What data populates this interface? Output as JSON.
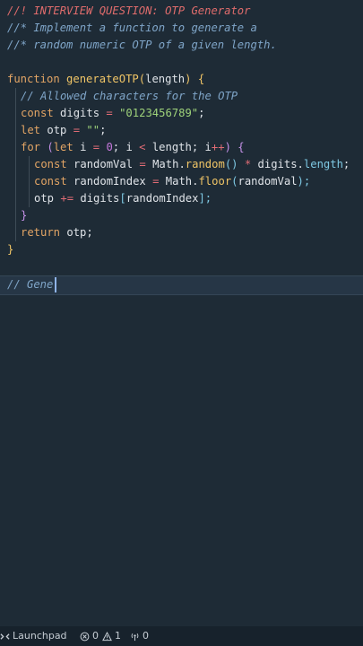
{
  "editor": {
    "lines": [
      {
        "indent": 0,
        "tokens": [
          {
            "t": "//! INTERVIEW QUESTION: OTP Generator",
            "c": "c-red"
          }
        ]
      },
      {
        "indent": 0,
        "tokens": [
          {
            "t": "//* Implement a function to generate a",
            "c": "c-com"
          }
        ]
      },
      {
        "indent": 0,
        "tokens": [
          {
            "t": "//* random numeric OTP of a given length.",
            "c": "c-com"
          }
        ]
      },
      {
        "indent": 0,
        "tokens": []
      },
      {
        "indent": 0,
        "tokens": [
          {
            "t": "function ",
            "c": "c-kw"
          },
          {
            "t": "generateOTP",
            "c": "c-fn"
          },
          {
            "t": "(",
            "c": "c-fn"
          },
          {
            "t": "length",
            "c": "c-pl"
          },
          {
            "t": ") {",
            "c": "c-fn"
          }
        ]
      },
      {
        "indent": 1,
        "tokens": [
          {
            "t": "// Allowed characters for the OTP",
            "c": "c-com"
          }
        ]
      },
      {
        "indent": 1,
        "tokens": [
          {
            "t": "const ",
            "c": "c-kw"
          },
          {
            "t": "digits ",
            "c": "c-pl"
          },
          {
            "t": "= ",
            "c": "c-op"
          },
          {
            "t": "\"0123456789\"",
            "c": "c-str"
          },
          {
            "t": ";",
            "c": "c-pl"
          }
        ]
      },
      {
        "indent": 1,
        "tokens": [
          {
            "t": "let ",
            "c": "c-kw"
          },
          {
            "t": "otp ",
            "c": "c-pl"
          },
          {
            "t": "= ",
            "c": "c-op"
          },
          {
            "t": "\"\"",
            "c": "c-str"
          },
          {
            "t": ";",
            "c": "c-pl"
          }
        ]
      },
      {
        "indent": 1,
        "tokens": [
          {
            "t": "for ",
            "c": "c-kw"
          },
          {
            "t": "(",
            "c": "c-br"
          },
          {
            "t": "let ",
            "c": "c-kw"
          },
          {
            "t": "i ",
            "c": "c-pl"
          },
          {
            "t": "= ",
            "c": "c-op"
          },
          {
            "t": "0",
            "c": "c-num"
          },
          {
            "t": "; i ",
            "c": "c-pl"
          },
          {
            "t": "< ",
            "c": "c-op"
          },
          {
            "t": "length; i",
            "c": "c-pl"
          },
          {
            "t": "++",
            "c": "c-op"
          },
          {
            "t": ") {",
            "c": "c-br"
          }
        ]
      },
      {
        "indent": 2,
        "tokens": [
          {
            "t": "const ",
            "c": "c-kw"
          },
          {
            "t": "randomVal ",
            "c": "c-pl"
          },
          {
            "t": "= ",
            "c": "c-op"
          },
          {
            "t": "Math.",
            "c": "c-pl"
          },
          {
            "t": "random",
            "c": "c-fn"
          },
          {
            "t": "() ",
            "c": "c-prop"
          },
          {
            "t": "* ",
            "c": "c-op"
          },
          {
            "t": "digits.",
            "c": "c-pl"
          },
          {
            "t": "length",
            "c": "c-prop"
          },
          {
            "t": ";",
            "c": "c-pl"
          }
        ]
      },
      {
        "indent": 2,
        "tokens": [
          {
            "t": "const ",
            "c": "c-kw"
          },
          {
            "t": "randomIndex ",
            "c": "c-pl"
          },
          {
            "t": "= ",
            "c": "c-op"
          },
          {
            "t": "Math.",
            "c": "c-pl"
          },
          {
            "t": "floor",
            "c": "c-fn"
          },
          {
            "t": "(",
            "c": "c-prop"
          },
          {
            "t": "randomVal",
            "c": "c-pl"
          },
          {
            "t": ");",
            "c": "c-prop"
          }
        ]
      },
      {
        "indent": 2,
        "tokens": [
          {
            "t": "otp ",
            "c": "c-pl"
          },
          {
            "t": "+= ",
            "c": "c-op"
          },
          {
            "t": "digits",
            "c": "c-pl"
          },
          {
            "t": "[",
            "c": "c-prop"
          },
          {
            "t": "randomIndex",
            "c": "c-pl"
          },
          {
            "t": "];",
            "c": "c-prop"
          }
        ]
      },
      {
        "indent": 1,
        "tokens": [
          {
            "t": "}",
            "c": "c-br"
          }
        ]
      },
      {
        "indent": 1,
        "tokens": [
          {
            "t": "return ",
            "c": "c-kw"
          },
          {
            "t": "otp;",
            "c": "c-pl"
          }
        ]
      },
      {
        "indent": 0,
        "tokens": [
          {
            "t": "}",
            "c": "c-fn"
          }
        ]
      },
      {
        "indent": 0,
        "tokens": []
      },
      {
        "indent": 0,
        "tokens": [
          {
            "t": "// Gene",
            "c": "c-com"
          }
        ]
      }
    ]
  },
  "statusbar": {
    "remote_label": "Launchpad",
    "errors": "0",
    "warnings": "1",
    "ports": "0"
  },
  "colors": {
    "background": "#1e2b36",
    "comment": "#7fa5c8",
    "keyword": "#e3a565",
    "function": "#f0c566",
    "string": "#9ed27a"
  }
}
